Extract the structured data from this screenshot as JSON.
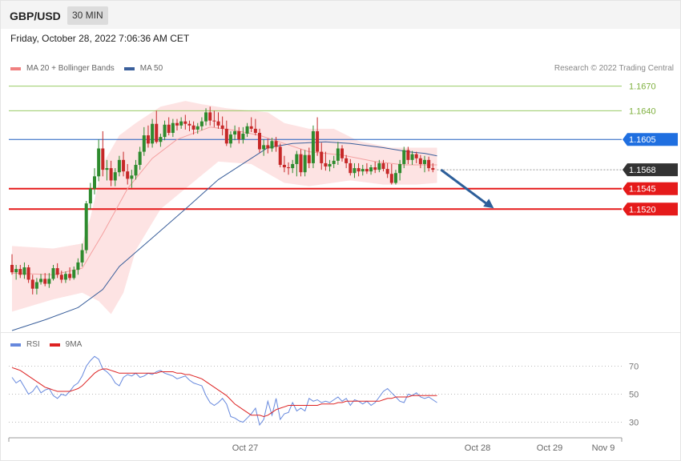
{
  "header": {
    "symbol": "GBP/USD",
    "timeframe": "30 MIN"
  },
  "datetime": "Friday, October 28, 2022 7:06:36 AM CET",
  "legend": [
    {
      "label": "MA 20 + Bollinger Bands",
      "color": "#f08080"
    },
    {
      "label": "MA 50",
      "color": "#3a5f9b"
    }
  ],
  "copyright": "Research © 2022 Trading Central",
  "rsi_legend": [
    {
      "label": "RSI",
      "color": "#6688dd"
    },
    {
      "label": "9MA",
      "color": "#dd2222"
    }
  ],
  "colors": {
    "up": "#2e8b2e",
    "down": "#c62828",
    "band": "#fde3e3",
    "ma20": "#f4a0a0",
    "ma50": "#3a5f9b",
    "current": "#333333",
    "pivot": "#1f5fbf",
    "support": "#e51a1a",
    "resistance": "#7fbf3f",
    "arrow": "#2d5f9a"
  },
  "chart_data": [
    {
      "type": "candlestick",
      "title": "GBP/USD",
      "timeframe": "30 MIN",
      "ylim": [
        1.5425,
        1.1695
      ],
      "x_ticks": [
        "Oct 27",
        "Oct 28",
        "Oct 29",
        "Nov 9"
      ],
      "levels": [
        {
          "value": 1.167,
          "label": "1.1670",
          "kind": "resistance"
        },
        {
          "value": 1.164,
          "label": "1.1640",
          "kind": "resistance"
        },
        {
          "value": 1.1605,
          "label": "1.1605",
          "kind": "pivot"
        },
        {
          "value": 1.1568,
          "label": "1.1568",
          "kind": "current"
        },
        {
          "value": 1.1545,
          "label": "1.1545",
          "kind": "support"
        },
        {
          "value": 1.152,
          "label": "1.1520",
          "kind": "support"
        }
      ],
      "ohlc": [
        [
          1.1452,
          1.1465,
          1.144,
          1.1443
        ],
        [
          1.1443,
          1.1452,
          1.1434,
          1.1447
        ],
        [
          1.1447,
          1.1452,
          1.1436,
          1.144
        ],
        [
          1.144,
          1.1455,
          1.1435,
          1.1449
        ],
        [
          1.1449,
          1.1452,
          1.143,
          1.1434
        ],
        [
          1.1434,
          1.144,
          1.1416,
          1.1423
        ],
        [
          1.1423,
          1.1436,
          1.1416,
          1.1431
        ],
        [
          1.1431,
          1.1441,
          1.1428,
          1.1435
        ],
        [
          1.1435,
          1.1442,
          1.1426,
          1.1429
        ],
        [
          1.1429,
          1.1442,
          1.1424,
          1.1435
        ],
        [
          1.1435,
          1.1452,
          1.1433,
          1.1448
        ],
        [
          1.1448,
          1.1454,
          1.1436,
          1.144
        ],
        [
          1.144,
          1.1445,
          1.143,
          1.1434
        ],
        [
          1.1434,
          1.1444,
          1.143,
          1.1441
        ],
        [
          1.1441,
          1.1449,
          1.1433,
          1.1436
        ],
        [
          1.1436,
          1.145,
          1.1434,
          1.1446
        ],
        [
          1.1446,
          1.146,
          1.144,
          1.1455
        ],
        [
          1.1455,
          1.1478,
          1.145,
          1.147
        ],
        [
          1.147,
          1.153,
          1.1466,
          1.1527
        ],
        [
          1.1527,
          1.1552,
          1.152,
          1.1545
        ],
        [
          1.1545,
          1.157,
          1.1538,
          1.156
        ],
        [
          1.156,
          1.1605,
          1.1554,
          1.1594
        ],
        [
          1.1594,
          1.1615,
          1.156,
          1.1568
        ],
        [
          1.1568,
          1.158,
          1.1555,
          1.157
        ],
        [
          1.157,
          1.1579,
          1.1548,
          1.1555
        ],
        [
          1.1555,
          1.157,
          1.1548,
          1.1565
        ],
        [
          1.1565,
          1.1585,
          1.156,
          1.158
        ],
        [
          1.158,
          1.159,
          1.156,
          1.1566
        ],
        [
          1.1566,
          1.1575,
          1.155,
          1.1557
        ],
        [
          1.1557,
          1.1568,
          1.1546,
          1.1561
        ],
        [
          1.1561,
          1.158,
          1.1556,
          1.1574
        ],
        [
          1.1574,
          1.1596,
          1.1568,
          1.159
        ],
        [
          1.159,
          1.162,
          1.1585,
          1.161
        ],
        [
          1.161,
          1.1622,
          1.1595,
          1.16
        ],
        [
          1.16,
          1.163,
          1.1595,
          1.1624
        ],
        [
          1.1624,
          1.164,
          1.16,
          1.1602
        ],
        [
          1.1602,
          1.1612,
          1.1596,
          1.1608
        ],
        [
          1.1608,
          1.1628,
          1.1604,
          1.1623
        ],
        [
          1.1623,
          1.1632,
          1.161,
          1.1613
        ],
        [
          1.1613,
          1.163,
          1.1608,
          1.1625
        ],
        [
          1.1625,
          1.163,
          1.1616,
          1.1622
        ],
        [
          1.1622,
          1.1632,
          1.1618,
          1.1627
        ],
        [
          1.1627,
          1.1635,
          1.1617,
          1.1624
        ],
        [
          1.1624,
          1.1628,
          1.1615,
          1.1622
        ],
        [
          1.1622,
          1.1627,
          1.1611,
          1.1617
        ],
        [
          1.1617,
          1.1625,
          1.1612,
          1.1621
        ],
        [
          1.1621,
          1.1632,
          1.1616,
          1.1627
        ],
        [
          1.1627,
          1.1643,
          1.1622,
          1.1638
        ],
        [
          1.1638,
          1.1645,
          1.1622,
          1.1628
        ],
        [
          1.1628,
          1.164,
          1.162,
          1.1627
        ],
        [
          1.1627,
          1.1638,
          1.1618,
          1.1622
        ],
        [
          1.1622,
          1.1633,
          1.161,
          1.1618
        ],
        [
          1.1618,
          1.1628,
          1.1597,
          1.16
        ],
        [
          1.16,
          1.1615,
          1.1595,
          1.1611
        ],
        [
          1.1611,
          1.1622,
          1.1604,
          1.1615
        ],
        [
          1.1615,
          1.162,
          1.16,
          1.1605
        ],
        [
          1.1605,
          1.162,
          1.16,
          1.1612
        ],
        [
          1.1612,
          1.1625,
          1.1608,
          1.1621
        ],
        [
          1.1621,
          1.1632,
          1.1614,
          1.1618
        ],
        [
          1.1618,
          1.163,
          1.161,
          1.1613
        ],
        [
          1.1613,
          1.1618,
          1.1589,
          1.1593
        ],
        [
          1.1593,
          1.1605,
          1.1585,
          1.1598
        ],
        [
          1.1598,
          1.1606,
          1.1588,
          1.1594
        ],
        [
          1.1594,
          1.1607,
          1.159,
          1.1603
        ],
        [
          1.1603,
          1.1608,
          1.159,
          1.1596
        ],
        [
          1.1596,
          1.16,
          1.1571,
          1.1574
        ],
        [
          1.1574,
          1.1585,
          1.1565,
          1.1571
        ],
        [
          1.1571,
          1.1577,
          1.1562,
          1.157
        ],
        [
          1.157,
          1.158,
          1.1564,
          1.1575
        ],
        [
          1.1575,
          1.1591,
          1.156,
          1.1587
        ],
        [
          1.1587,
          1.1593,
          1.156,
          1.1565
        ],
        [
          1.1565,
          1.1592,
          1.156,
          1.1586
        ],
        [
          1.1586,
          1.1595,
          1.157,
          1.1576
        ],
        [
          1.1576,
          1.1622,
          1.157,
          1.1615
        ],
        [
          1.1615,
          1.1632,
          1.1585,
          1.159
        ],
        [
          1.159,
          1.1601,
          1.1568,
          1.1576
        ],
        [
          1.1576,
          1.159,
          1.1567,
          1.1572
        ],
        [
          1.1572,
          1.158,
          1.1566,
          1.1575
        ],
        [
          1.1575,
          1.1585,
          1.157,
          1.1579
        ],
        [
          1.1579,
          1.1602,
          1.1574,
          1.1594
        ],
        [
          1.1594,
          1.1598,
          1.1578,
          1.1582
        ],
        [
          1.1582,
          1.1586,
          1.157,
          1.1576
        ],
        [
          1.1576,
          1.1581,
          1.1561,
          1.1564
        ],
        [
          1.1564,
          1.1576,
          1.1558,
          1.157
        ],
        [
          1.157,
          1.1576,
          1.156,
          1.1566
        ],
        [
          1.1566,
          1.1574,
          1.1561,
          1.1569
        ],
        [
          1.1569,
          1.1576,
          1.1563,
          1.1566
        ],
        [
          1.1566,
          1.1574,
          1.1562,
          1.1571
        ],
        [
          1.1571,
          1.1578,
          1.1564,
          1.1568
        ],
        [
          1.1568,
          1.158,
          1.1565,
          1.1576
        ],
        [
          1.1576,
          1.158,
          1.1566,
          1.1569
        ],
        [
          1.1569,
          1.1576,
          1.1558,
          1.1563
        ],
        [
          1.1563,
          1.1575,
          1.155,
          1.1552
        ],
        [
          1.1552,
          1.1568,
          1.155,
          1.1564
        ],
        [
          1.1564,
          1.158,
          1.1555,
          1.1575
        ],
        [
          1.1575,
          1.1596,
          1.157,
          1.1592
        ],
        [
          1.1592,
          1.1596,
          1.1575,
          1.158
        ],
        [
          1.158,
          1.1591,
          1.1574,
          1.1587
        ],
        [
          1.1587,
          1.159,
          1.1576,
          1.1582
        ],
        [
          1.1582,
          1.1586,
          1.157,
          1.1575
        ],
        [
          1.1575,
          1.1585,
          1.1565,
          1.158
        ],
        [
          1.158,
          1.1584,
          1.1566,
          1.157
        ],
        [
          1.157,
          1.1576,
          1.1565,
          1.1568
        ]
      ],
      "ma20": [
        [
          0,
          1.1442
        ],
        [
          10,
          1.144
        ],
        [
          17,
          1.1448
        ],
        [
          22,
          1.149
        ],
        [
          28,
          1.1545
        ],
        [
          34,
          1.1582
        ],
        [
          40,
          1.1605
        ],
        [
          48,
          1.162
        ],
        [
          54,
          1.1616
        ],
        [
          60,
          1.161
        ],
        [
          66,
          1.16
        ],
        [
          72,
          1.159
        ],
        [
          80,
          1.1586
        ],
        [
          88,
          1.1578
        ],
        [
          95,
          1.1574
        ],
        [
          103,
          1.1574
        ]
      ],
      "bb_upper": [
        [
          0,
          1.1475
        ],
        [
          10,
          1.1472
        ],
        [
          17,
          1.1478
        ],
        [
          19,
          1.151
        ],
        [
          22,
          1.1575
        ],
        [
          26,
          1.161
        ],
        [
          30,
          1.1625
        ],
        [
          36,
          1.1645
        ],
        [
          42,
          1.1652
        ],
        [
          46,
          1.1648
        ],
        [
          52,
          1.1643
        ],
        [
          58,
          1.164
        ],
        [
          62,
          1.1638
        ],
        [
          66,
          1.1625
        ],
        [
          72,
          1.1618
        ],
        [
          78,
          1.1618
        ],
        [
          84,
          1.1603
        ],
        [
          92,
          1.1595
        ],
        [
          98,
          1.1595
        ],
        [
          103,
          1.1595
        ]
      ],
      "bb_lower": [
        [
          0,
          1.1395
        ],
        [
          10,
          1.141
        ],
        [
          17,
          1.1418
        ],
        [
          21,
          1.1408
        ],
        [
          24,
          1.1392
        ],
        [
          27,
          1.1418
        ],
        [
          30,
          1.147
        ],
        [
          36,
          1.152
        ],
        [
          42,
          1.1545
        ],
        [
          50,
          1.1578
        ],
        [
          58,
          1.1575
        ],
        [
          66,
          1.1552
        ],
        [
          72,
          1.1548
        ],
        [
          82,
          1.1555
        ],
        [
          90,
          1.155
        ],
        [
          98,
          1.155
        ],
        [
          103,
          1.1552
        ]
      ],
      "ma50": [
        [
          0,
          1.1372
        ],
        [
          8,
          1.1385
        ],
        [
          16,
          1.14
        ],
        [
          22,
          1.1422
        ],
        [
          26,
          1.145
        ],
        [
          34,
          1.1485
        ],
        [
          42,
          1.152
        ],
        [
          50,
          1.1556
        ],
        [
          58,
          1.1582
        ],
        [
          62,
          1.1595
        ],
        [
          68,
          1.16
        ],
        [
          76,
          1.1602
        ],
        [
          82,
          1.16
        ],
        [
          90,
          1.1595
        ],
        [
          96,
          1.159
        ],
        [
          100,
          1.1588
        ],
        [
          103,
          1.1585
        ]
      ],
      "forecast_arrow": {
        "from": [
          103,
          1.1568
        ],
        "to": [
          116,
          1.1521
        ]
      }
    },
    {
      "type": "line",
      "title": "RSI",
      "ylim": [
        20,
        80
      ],
      "y_ticks": [
        70,
        50,
        30
      ],
      "series": [
        {
          "name": "RSI",
          "values": [
            62,
            58,
            60,
            55,
            50,
            52,
            56,
            51,
            53,
            54,
            49,
            47,
            50,
            49,
            52,
            56,
            58,
            63,
            70,
            74,
            77,
            75,
            68,
            66,
            63,
            58,
            56,
            62,
            64,
            63,
            65,
            62,
            63,
            65,
            64,
            66,
            67,
            65,
            64,
            63,
            61,
            62,
            63,
            60,
            58,
            57,
            56,
            49,
            44,
            42,
            44,
            47,
            43,
            34,
            33,
            31,
            30,
            33,
            36,
            40,
            28,
            32,
            45,
            35,
            47,
            32,
            36,
            37,
            44,
            38,
            40,
            38,
            47,
            45,
            46,
            44,
            45,
            44,
            46,
            48,
            45,
            47,
            42,
            46,
            45,
            43,
            45,
            42,
            44,
            48,
            52,
            54,
            51,
            48,
            45,
            44,
            50,
            49,
            51,
            48,
            47,
            48,
            46,
            44
          ]
        },
        {
          "name": "9MA",
          "values": [
            69,
            68,
            67,
            65,
            63,
            61,
            59,
            57,
            55,
            54,
            53,
            52,
            52,
            52,
            52,
            53,
            54,
            56,
            59,
            62,
            65,
            67,
            68,
            68,
            67,
            66,
            65,
            65,
            65,
            65,
            65,
            65,
            65,
            65,
            65,
            65,
            66,
            66,
            66,
            66,
            65,
            65,
            64,
            64,
            63,
            62,
            61,
            59,
            57,
            55,
            53,
            51,
            49,
            46,
            43,
            41,
            39,
            37,
            35,
            35,
            35,
            34,
            35,
            37,
            39,
            40,
            41,
            42,
            42,
            42,
            42,
            42,
            42,
            42,
            42,
            43,
            43,
            43,
            43,
            44,
            44,
            45,
            45,
            45,
            45,
            45,
            45,
            45,
            45,
            45,
            46,
            47,
            47,
            48,
            48,
            48,
            48,
            49,
            49,
            49,
            49,
            49,
            49,
            49
          ]
        }
      ]
    }
  ]
}
